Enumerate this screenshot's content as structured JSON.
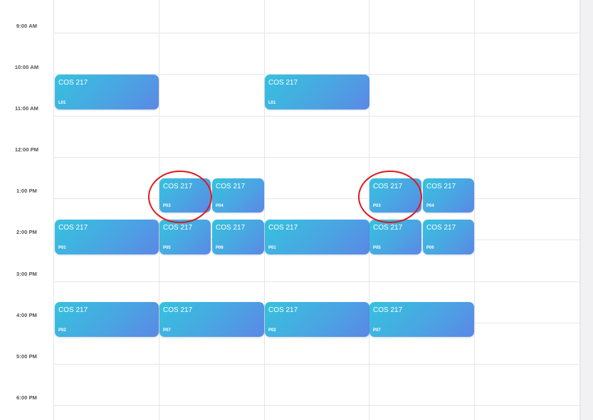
{
  "time_labels": [
    "9:00 AM",
    "10:00 AM",
    "11:00 AM",
    "12:00 PM",
    "1:00 PM",
    "2:00 PM",
    "3:00 PM",
    "4:00 PM",
    "5:00 PM",
    "6:00 PM"
  ],
  "events": [
    {
      "title": "COS 217",
      "section": "L01"
    },
    {
      "title": "COS 217",
      "section": "L01"
    },
    {
      "title": "COS 217",
      "section": "P03"
    },
    {
      "title": "COS 217",
      "section": "P04"
    },
    {
      "title": "COS 217",
      "section": "P03"
    },
    {
      "title": "COS 217",
      "section": "P04"
    },
    {
      "title": "COS 217",
      "section": "P01"
    },
    {
      "title": "COS 217",
      "section": "P05"
    },
    {
      "title": "COS 217",
      "section": "P06"
    },
    {
      "title": "COS 217",
      "section": "P01"
    },
    {
      "title": "COS 217",
      "section": "P05"
    },
    {
      "title": "COS 217",
      "section": "P06"
    },
    {
      "title": "COS 217",
      "section": "P02"
    },
    {
      "title": "COS 217",
      "section": "P07"
    },
    {
      "title": "COS 217",
      "section": "P02"
    },
    {
      "title": "COS 217",
      "section": "P07"
    }
  ],
  "colors": {
    "event_start": "#35c2de",
    "event_end": "#5b88e6",
    "highlight_circle": "#e0181b"
  }
}
